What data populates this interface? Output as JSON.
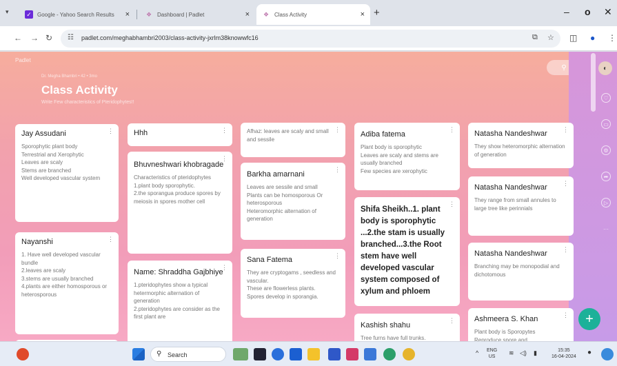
{
  "browser": {
    "tabs": [
      {
        "label": "Google - Yahoo Search Results",
        "active": false
      },
      {
        "label": "Dashboard | Padlet",
        "active": false
      },
      {
        "label": "Class Activity",
        "active": true
      }
    ],
    "url": "padlet.com/meghabhambri2003/class-activity-jxrlm38knowwfc16"
  },
  "padlet": {
    "brand": "Padlet",
    "author_line": "Dr. Megha Bhambri • 42 • 3mo",
    "title": "Class Activity",
    "subtitle": "Write Few characteristics of Pteridophytes!!",
    "columns": [
      [
        {
          "name": "Jay Assudani",
          "body": "Sporophytic plant body\nTerrestrial and Xerophytic\nLeaves are scaly\nStems are branched\nWell developed vascular system"
        },
        {
          "name": "Nayanshi",
          "body": "1. Have well developed vascular bundle\n2.leaves are scaly\n3.stems are usually branched\n4.plants are either homosporous or heterosporous"
        },
        {
          "name": "",
          "body": ""
        }
      ],
      [
        {
          "name": "Hhh",
          "body": ""
        },
        {
          "name": "Bhuvneshwari khobragade",
          "body": "Characteristics of pteridophytes\n1.plant body sporophytic.\n2.the sporangua produce spores by meiosis in spores mother cell"
        },
        {
          "name": "Name: Shraddha Gajbhiye",
          "body": "1.pteridophytes show a typical hetermorphic alternation of generation\n2.pteridophytes are consider as the first plant are"
        }
      ],
      [
        {
          "name": "",
          "body": "Afhaz: leaves are scaly and small and sessile"
        },
        {
          "name": "Barkha amarnani",
          "body": "Leaves are sessile and small\nPlants can be homosporous Or heterosporous\nHeteromorphic alternation of generation"
        },
        {
          "name": "Sana Fatema",
          "body": "They are cryptogams , seedless and vascular.\nThese are flowerless plants.\nSpores develop in sporangia."
        }
      ],
      [
        {
          "name": "Adiba fatema",
          "body": "Plant body is sporophytic\nLeaves are scaly and stems are usually branched\nFew species are xerophytic"
        },
        {
          "name": "Shifa Sheikh..1. plant body is sporophytic ...2.the stam is usually branched...3.the Root stem have well developed vascular system composed of xylum and phloem",
          "body": ""
        },
        {
          "name": "Kashish shahu",
          "body": "Tree furns have full trunks."
        }
      ],
      [
        {
          "name": "Natasha Nandeshwar",
          "body": "They show heteromorphic alternation of generation"
        },
        {
          "name": "Natasha Nandeshwar",
          "body": "They range from small annules to large tree like perinnials"
        },
        {
          "name": "Natasha Nandeshwar",
          "body": "Branching may be monopodial and dichotomous"
        },
        {
          "name": "Ashmeera S. Khan",
          "body": "Plant body is Sporopytes\nReproduce spore and"
        }
      ]
    ]
  },
  "taskbar": {
    "search_label": "Search",
    "tray_lang": "ENG",
    "tray_region": "US",
    "time": "15:35",
    "date": "16-04-2024"
  }
}
